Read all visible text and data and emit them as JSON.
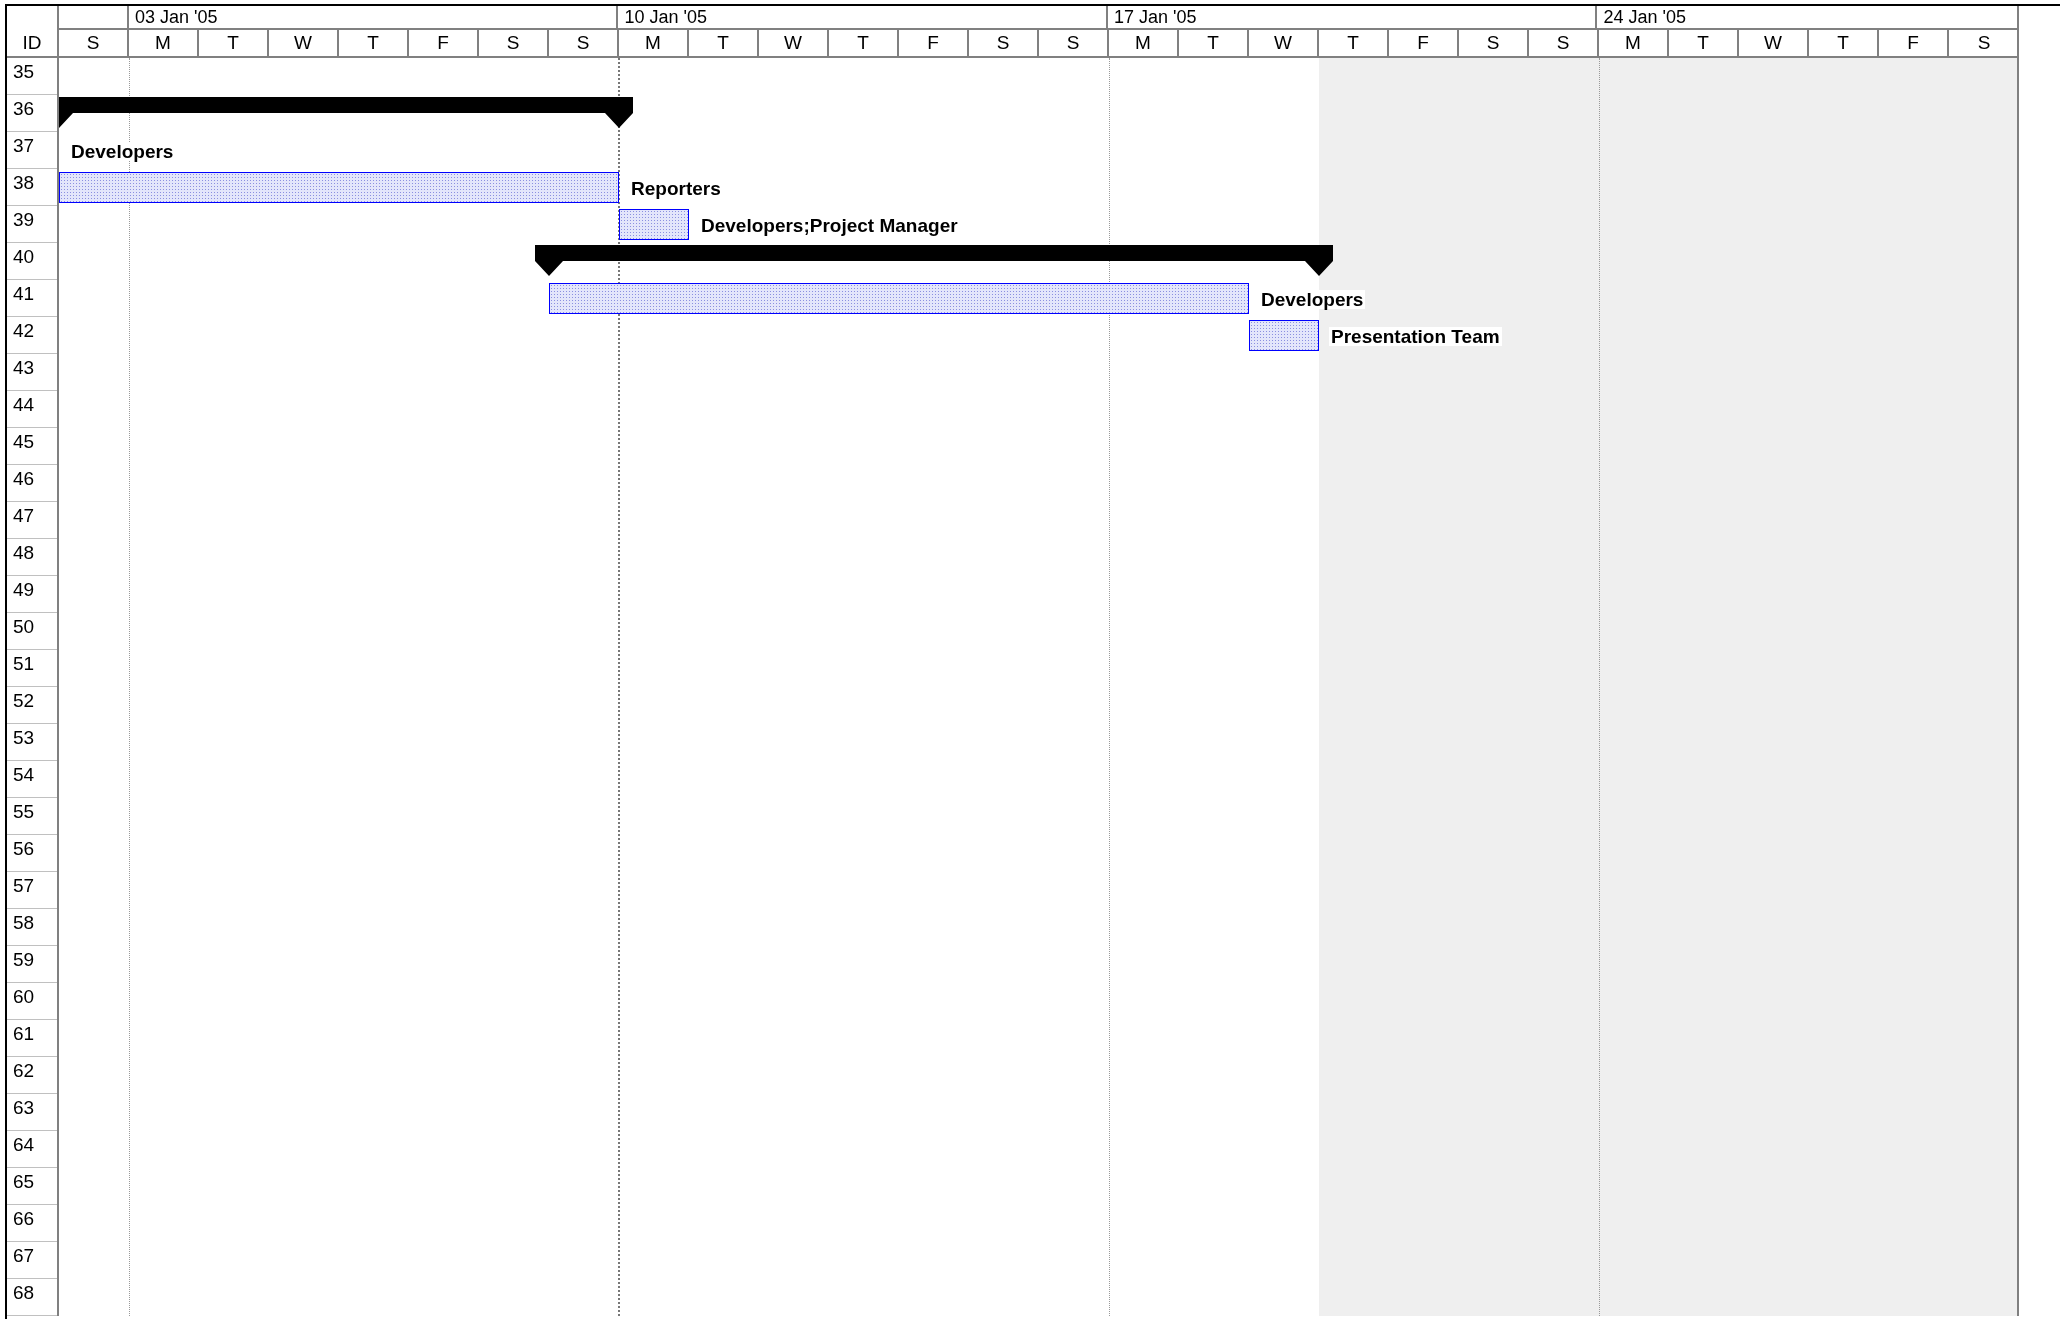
{
  "header": {
    "id_label": "ID",
    "leading_days": [
      {
        "label": "S",
        "shaded": false
      }
    ],
    "weeks": [
      {
        "label": "03 Jan '05",
        "current": false,
        "days": [
          {
            "label": "M",
            "shaded": false
          },
          {
            "label": "T",
            "shaded": false
          },
          {
            "label": "W",
            "shaded": false
          },
          {
            "label": "T",
            "shaded": false
          },
          {
            "label": "F",
            "shaded": false
          },
          {
            "label": "S",
            "shaded": false
          },
          {
            "label": "S",
            "shaded": false
          }
        ]
      },
      {
        "label": "10 Jan '05",
        "current": true,
        "days": [
          {
            "label": "M",
            "shaded": false
          },
          {
            "label": "T",
            "shaded": false
          },
          {
            "label": "W",
            "shaded": false
          },
          {
            "label": "T",
            "shaded": false
          },
          {
            "label": "F",
            "shaded": false
          },
          {
            "label": "S",
            "shaded": false
          },
          {
            "label": "S",
            "shaded": false
          }
        ]
      },
      {
        "label": "17 Jan '05",
        "current": false,
        "days": [
          {
            "label": "M",
            "shaded": false
          },
          {
            "label": "T",
            "shaded": false
          },
          {
            "label": "W",
            "shaded": false
          },
          {
            "label": "T",
            "shaded": true
          },
          {
            "label": "F",
            "shaded": true
          },
          {
            "label": "S",
            "shaded": true
          },
          {
            "label": "S",
            "shaded": true
          }
        ]
      },
      {
        "label": "24 Jan '05",
        "current": false,
        "days": [
          {
            "label": "M",
            "shaded": true
          },
          {
            "label": "T",
            "shaded": true
          },
          {
            "label": "W",
            "shaded": true
          },
          {
            "label": "T",
            "shaded": true
          },
          {
            "label": "F",
            "shaded": true
          },
          {
            "label": "S",
            "shaded": true
          }
        ]
      }
    ]
  },
  "rows": [
    {
      "id": "35"
    },
    {
      "id": "36",
      "bar": {
        "kind": "summary"
      }
    },
    {
      "id": "37",
      "bar": {
        "kind": "label",
        "resource": "Developers"
      }
    },
    {
      "id": "38",
      "bar": {
        "kind": "task",
        "resource": "Reporters"
      }
    },
    {
      "id": "39",
      "bar": {
        "kind": "task",
        "resource": "Developers;Project Manager"
      }
    },
    {
      "id": "40",
      "bar": {
        "kind": "summary"
      }
    },
    {
      "id": "41",
      "bar": {
        "kind": "task",
        "resource": "Developers"
      }
    },
    {
      "id": "42",
      "bar": {
        "kind": "task",
        "resource": "Presentation Team"
      }
    },
    {
      "id": "43"
    },
    {
      "id": "44"
    },
    {
      "id": "45"
    },
    {
      "id": "46"
    },
    {
      "id": "47"
    },
    {
      "id": "48"
    },
    {
      "id": "49"
    },
    {
      "id": "50"
    },
    {
      "id": "51"
    },
    {
      "id": "52"
    },
    {
      "id": "53"
    },
    {
      "id": "54"
    },
    {
      "id": "55"
    },
    {
      "id": "56"
    },
    {
      "id": "57"
    },
    {
      "id": "58"
    },
    {
      "id": "59"
    },
    {
      "id": "60"
    },
    {
      "id": "61"
    },
    {
      "id": "62"
    },
    {
      "id": "63"
    },
    {
      "id": "64"
    },
    {
      "id": "65"
    },
    {
      "id": "66"
    },
    {
      "id": "67"
    },
    {
      "id": "68"
    }
  ]
}
